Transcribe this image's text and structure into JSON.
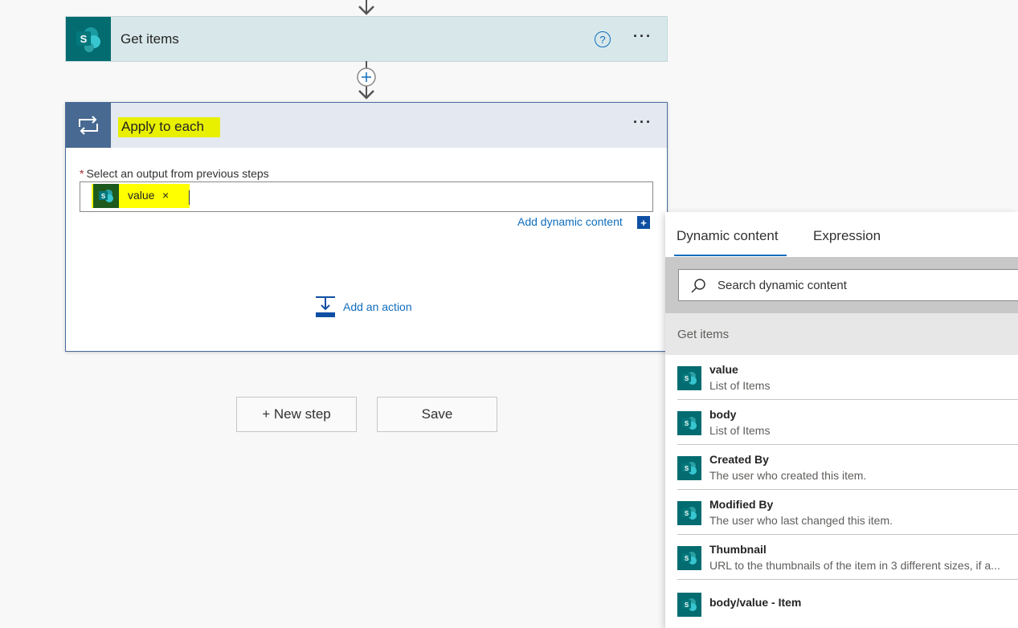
{
  "get_items_card": {
    "title": "Get items",
    "icon_letter": "S",
    "help_symbol": "?",
    "menu": "···"
  },
  "apply_card": {
    "title": "Apply to each",
    "menu": "···",
    "field_label": "Select an output from previous steps",
    "required_mark": "*",
    "token": {
      "label": "value",
      "remove": "×",
      "icon_letter": "S"
    },
    "add_dynamic_content": "Add dynamic content",
    "add_dynamic_symbol": "+",
    "add_action": "Add an action"
  },
  "buttons": {
    "new_step": "+ New step",
    "save": "Save"
  },
  "dynamic_panel": {
    "tabs": [
      {
        "label": "Dynamic content",
        "active": true
      },
      {
        "label": "Expression",
        "active": false
      }
    ],
    "search_placeholder": "Search dynamic content",
    "section": "Get items",
    "items": [
      {
        "name": "value",
        "desc": "List of Items"
      },
      {
        "name": "body",
        "desc": "List of Items"
      },
      {
        "name": "Created By",
        "desc": "The user who created this item."
      },
      {
        "name": "Modified By",
        "desc": "The user who last changed this item."
      },
      {
        "name": "Thumbnail",
        "desc": "URL to the thumbnails of the item in 3 different sizes, if a..."
      },
      {
        "name": "body/value - Item",
        "desc": ""
      }
    ]
  },
  "colors": {
    "sharepoint": "#036c70",
    "loop": "#486991",
    "link": "#0f6cbd",
    "highlight": "#e8f000"
  }
}
